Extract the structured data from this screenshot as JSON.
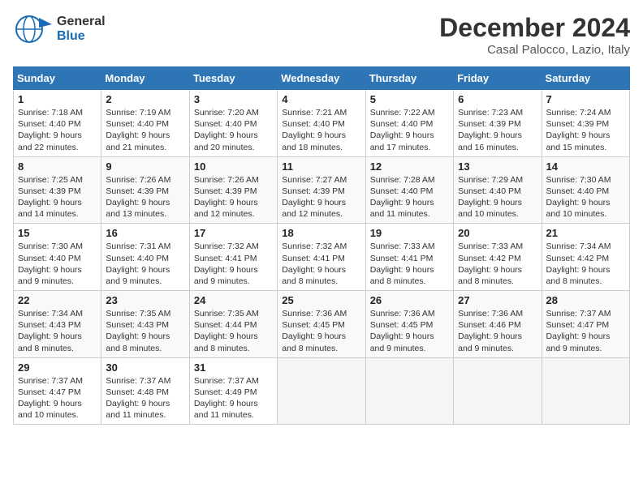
{
  "header": {
    "logo_general": "General",
    "logo_blue": "Blue",
    "month": "December 2024",
    "location": "Casal Palocco, Lazio, Italy"
  },
  "days_of_week": [
    "Sunday",
    "Monday",
    "Tuesday",
    "Wednesday",
    "Thursday",
    "Friday",
    "Saturday"
  ],
  "weeks": [
    [
      {
        "day": 1,
        "sunrise": "7:18 AM",
        "sunset": "4:40 PM",
        "daylight": "9 hours and 22 minutes."
      },
      {
        "day": 2,
        "sunrise": "7:19 AM",
        "sunset": "4:40 PM",
        "daylight": "9 hours and 21 minutes."
      },
      {
        "day": 3,
        "sunrise": "7:20 AM",
        "sunset": "4:40 PM",
        "daylight": "9 hours and 20 minutes."
      },
      {
        "day": 4,
        "sunrise": "7:21 AM",
        "sunset": "4:40 PM",
        "daylight": "9 hours and 18 minutes."
      },
      {
        "day": 5,
        "sunrise": "7:22 AM",
        "sunset": "4:40 PM",
        "daylight": "9 hours and 17 minutes."
      },
      {
        "day": 6,
        "sunrise": "7:23 AM",
        "sunset": "4:39 PM",
        "daylight": "9 hours and 16 minutes."
      },
      {
        "day": 7,
        "sunrise": "7:24 AM",
        "sunset": "4:39 PM",
        "daylight": "9 hours and 15 minutes."
      }
    ],
    [
      {
        "day": 8,
        "sunrise": "7:25 AM",
        "sunset": "4:39 PM",
        "daylight": "9 hours and 14 minutes."
      },
      {
        "day": 9,
        "sunrise": "7:26 AM",
        "sunset": "4:39 PM",
        "daylight": "9 hours and 13 minutes."
      },
      {
        "day": 10,
        "sunrise": "7:26 AM",
        "sunset": "4:39 PM",
        "daylight": "9 hours and 12 minutes."
      },
      {
        "day": 11,
        "sunrise": "7:27 AM",
        "sunset": "4:39 PM",
        "daylight": "9 hours and 12 minutes."
      },
      {
        "day": 12,
        "sunrise": "7:28 AM",
        "sunset": "4:40 PM",
        "daylight": "9 hours and 11 minutes."
      },
      {
        "day": 13,
        "sunrise": "7:29 AM",
        "sunset": "4:40 PM",
        "daylight": "9 hours and 10 minutes."
      },
      {
        "day": 14,
        "sunrise": "7:30 AM",
        "sunset": "4:40 PM",
        "daylight": "9 hours and 10 minutes."
      }
    ],
    [
      {
        "day": 15,
        "sunrise": "7:30 AM",
        "sunset": "4:40 PM",
        "daylight": "9 hours and 9 minutes."
      },
      {
        "day": 16,
        "sunrise": "7:31 AM",
        "sunset": "4:40 PM",
        "daylight": "9 hours and 9 minutes."
      },
      {
        "day": 17,
        "sunrise": "7:32 AM",
        "sunset": "4:41 PM",
        "daylight": "9 hours and 9 minutes."
      },
      {
        "day": 18,
        "sunrise": "7:32 AM",
        "sunset": "4:41 PM",
        "daylight": "9 hours and 8 minutes."
      },
      {
        "day": 19,
        "sunrise": "7:33 AM",
        "sunset": "4:41 PM",
        "daylight": "9 hours and 8 minutes."
      },
      {
        "day": 20,
        "sunrise": "7:33 AM",
        "sunset": "4:42 PM",
        "daylight": "9 hours and 8 minutes."
      },
      {
        "day": 21,
        "sunrise": "7:34 AM",
        "sunset": "4:42 PM",
        "daylight": "9 hours and 8 minutes."
      }
    ],
    [
      {
        "day": 22,
        "sunrise": "7:34 AM",
        "sunset": "4:43 PM",
        "daylight": "9 hours and 8 minutes."
      },
      {
        "day": 23,
        "sunrise": "7:35 AM",
        "sunset": "4:43 PM",
        "daylight": "9 hours and 8 minutes."
      },
      {
        "day": 24,
        "sunrise": "7:35 AM",
        "sunset": "4:44 PM",
        "daylight": "9 hours and 8 minutes."
      },
      {
        "day": 25,
        "sunrise": "7:36 AM",
        "sunset": "4:45 PM",
        "daylight": "9 hours and 8 minutes."
      },
      {
        "day": 26,
        "sunrise": "7:36 AM",
        "sunset": "4:45 PM",
        "daylight": "9 hours and 9 minutes."
      },
      {
        "day": 27,
        "sunrise": "7:36 AM",
        "sunset": "4:46 PM",
        "daylight": "9 hours and 9 minutes."
      },
      {
        "day": 28,
        "sunrise": "7:37 AM",
        "sunset": "4:47 PM",
        "daylight": "9 hours and 9 minutes."
      }
    ],
    [
      {
        "day": 29,
        "sunrise": "7:37 AM",
        "sunset": "4:47 PM",
        "daylight": "9 hours and 10 minutes."
      },
      {
        "day": 30,
        "sunrise": "7:37 AM",
        "sunset": "4:48 PM",
        "daylight": "9 hours and 11 minutes."
      },
      {
        "day": 31,
        "sunrise": "7:37 AM",
        "sunset": "4:49 PM",
        "daylight": "9 hours and 11 minutes."
      },
      null,
      null,
      null,
      null
    ]
  ]
}
